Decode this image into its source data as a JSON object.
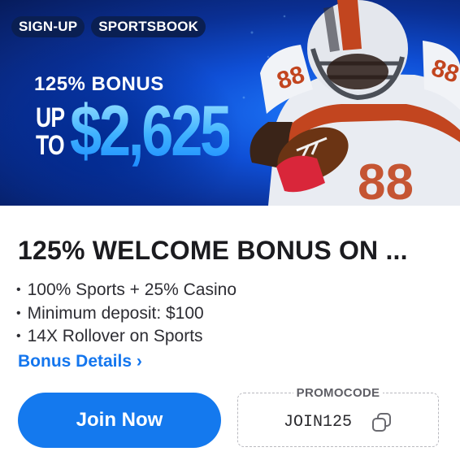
{
  "banner": {
    "tags": [
      "SIGN-UP",
      "SPORTSBOOK"
    ],
    "bonus_line": "125% BONUS",
    "up_to": [
      "UP",
      "TO"
    ],
    "amount": "$2,625",
    "jersey_number": "88"
  },
  "offer": {
    "title": "125% WELCOME BONUS ON ...",
    "features": [
      "100% Sports + 25% Casino",
      "Minimum deposit: $100",
      "14X Rollover on Sports"
    ],
    "details_link": "Bonus Details ›"
  },
  "actions": {
    "join_label": "Join Now",
    "promo_label": "PROMOCODE",
    "promo_code": "JOIN125"
  },
  "colors": {
    "accent_blue": "#1479ee",
    "tag_bg": "#0a1f52",
    "amount_blue": "#4fc3ff"
  },
  "icons": {
    "copy": "copy-icon"
  }
}
